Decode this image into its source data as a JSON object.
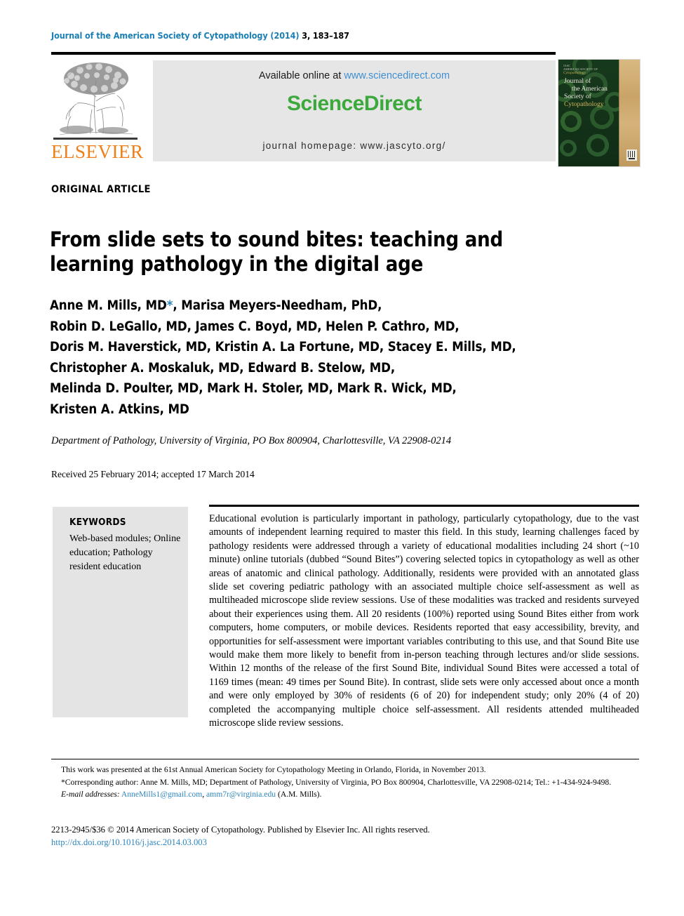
{
  "running_head": {
    "journal": "Journal of the American Society of Cytopathology (2014)",
    "pages": "3, 183–187"
  },
  "banner": {
    "publisher_name": "ELSEVIER",
    "tree_logo_name": "elsevier-tree-logo",
    "available_prefix": "Available online at ",
    "available_url": "www.sciencedirect.com",
    "sciencedirect_logo": "ScienceDirect",
    "homepage": "journal homepage: www.jascyto.org/",
    "sciencedirect_green": "#3da93d",
    "elsevier_orange": "#f07f1a",
    "link_blue": "#2e86c0"
  },
  "cover": {
    "top_label_line1": "JASC",
    "top_label_line2": "AMERICAN SOCIETY OF",
    "top_label_line3": "Cytopathology",
    "title_line1": "Journal of",
    "title_line2": "the American",
    "title_line3": "Society of",
    "title_line4": "Cytopathology"
  },
  "article": {
    "type": "ORIGINAL ARTICLE",
    "title": "From slide sets to sound bites: teaching and learning pathology in the digital age",
    "authors_lines": [
      "Anne M. Mills, MD*, Marisa Meyers-Needham, PhD,",
      "Robin D. LeGallo, MD, James C. Boyd, MD, Helen P. Cathro, MD,",
      "Doris M. Haverstick, MD, Kristin A. La Fortune, MD, Stacey E. Mills, MD,",
      "Christopher A. Moskaluk, MD, Edward B. Stelow, MD,",
      "Melinda D. Poulter, MD, Mark H. Stoler, MD, Mark R. Wick, MD,",
      "Kristen A. Atkins, MD"
    ],
    "affiliation": "Department of Pathology, University of Virginia, PO Box 800904, Charlottesville, VA 22908-0214",
    "received": "Received 25 February 2014; accepted 17 March 2014"
  },
  "keywords": {
    "heading": "KEYWORDS",
    "items": "Web-based modules; Online education; Pathology resident education"
  },
  "abstract": {
    "text": "Educational evolution is particularly important in pathology, particularly cytopathology, due to the vast amounts of independent learning required to master this field. In this study, learning challenges faced by pathology residents were addressed through a variety of educational modalities including 24 short (~10 minute) online tutorials (dubbed “Sound Bites”) covering selected topics in cytopathology as well as other areas of anatomic and clinical pathology. Additionally, residents were provided with an annotated glass slide set covering pediatric pathology with an associated multiple choice self-assessment as well as multiheaded microscope slide review sessions. Use of these modalities was tracked and residents surveyed about their experiences using them. All 20 residents (100%) reported using Sound Bites either from work computers, home computers, or mobile devices. Residents reported that easy accessibility, brevity, and opportunities for self-assessment were important variables contributing to this use, and that Sound Bite use would make them more likely to benefit from in-person teaching through lectures and/or slide sessions. Within 12 months of the release of the first Sound Bite, individual Sound Bites were accessed a total of 1169 times (mean: 49 times per Sound Bite). In contrast, slide sets were only accessed about once a month and were only employed by 30% of residents (6 of 20) for independent study; only 20% (4 of 20) completed the accompanying multiple choice self-assessment. All residents attended multiheaded microscope slide review sessions."
  },
  "footnotes": {
    "presented": "This work was presented at the 61st Annual American Society for Cytopathology Meeting in Orlando, Florida, in November 2013.",
    "corresponding": "*Corresponding author: Anne M. Mills, MD; Department of Pathology, University of Virginia, PO Box 800904, Charlottesville, VA 22908-0214; Tel.: +1-434-924-9498.",
    "email_label": "E-mail addresses:",
    "email1": "AnneMills1@gmail.com",
    "email2": "amm7r@virginia.edu",
    "email_suffix": "(A.M. Mills)."
  },
  "copyright": {
    "line": "2213-2945/$36 © 2014 American Society of Cytopathology. Published by Elsevier Inc. All rights reserved.",
    "doi": "http://dx.doi.org/10.1016/j.jasc.2014.03.003"
  }
}
